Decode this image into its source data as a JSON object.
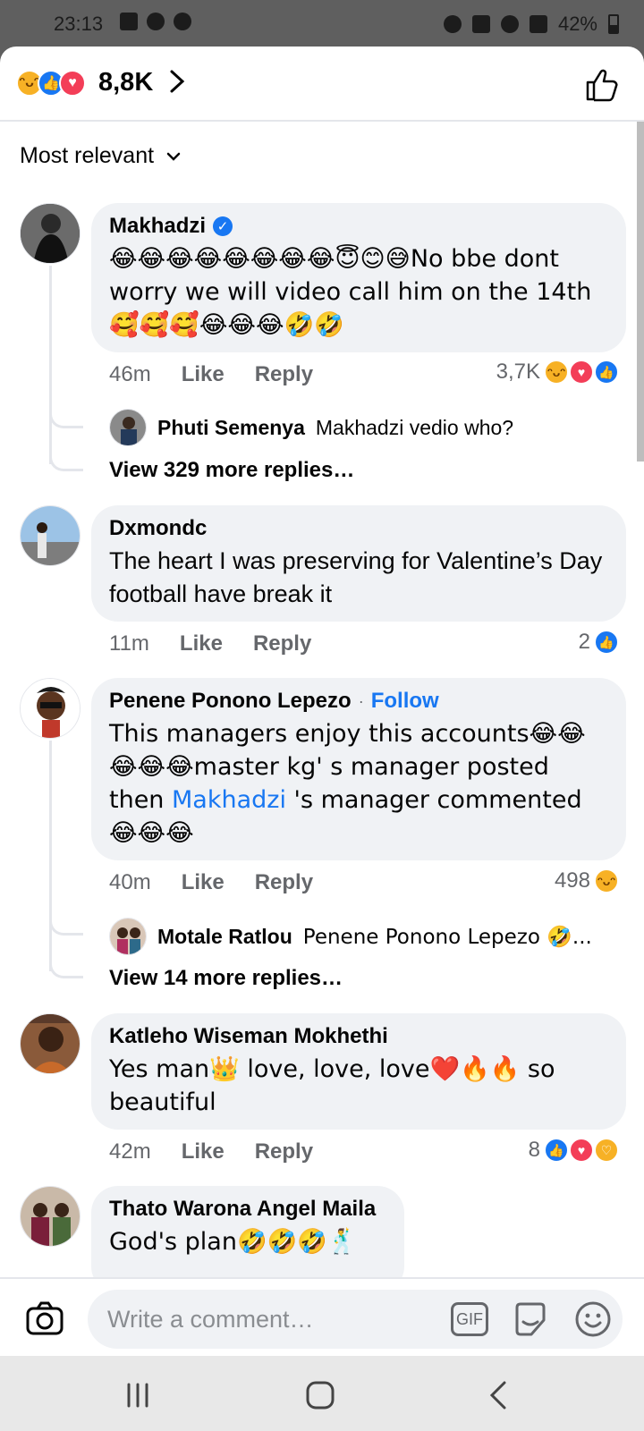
{
  "status_bar": {
    "time": "23:13",
    "battery": "42%"
  },
  "header": {
    "reaction_total": "8,8K"
  },
  "sort": {
    "label": "Most relevant"
  },
  "comments": [
    {
      "author": "Makhadzi",
      "verified": true,
      "text": "😂😂😂😂😂😂😂😂😇😊😅No bbe dont worry we will video call him on the 14th 🥰🥰🥰😂😂😂🤣🤣",
      "time": "46m",
      "like": "Like",
      "reply": "Reply",
      "reaction_count": "3,7K",
      "reply_preview": {
        "author": "Phuti Semenya",
        "text": "Makhadzi vedio who?"
      },
      "view_more": "View 329 more replies…"
    },
    {
      "author": "Dxmondc",
      "text": "The heart I was preserving for Valentine’s Day football have break it",
      "time": "11m",
      "like": "Like",
      "reply": "Reply",
      "reaction_count": "2"
    },
    {
      "author": "Penene Ponono Lepezo",
      "follow": "Follow",
      "text_a": "This managers enjoy this accounts😂😂😂😂😂master kg' s manager posted then ",
      "text_link": "Makhadzi",
      "text_b": " 's manager commented 😂😂😂",
      "time": "40m",
      "like": "Like",
      "reply": "Reply",
      "reaction_count": "498",
      "reply_preview": {
        "author": "Motale Ratlou",
        "text": "Penene Ponono Lepezo 🤣..."
      },
      "view_more": "View 14 more replies…"
    },
    {
      "author": "Katleho Wiseman Mokhethi",
      "text": "Yes man👑 love, love, love❤️🔥🔥 so beautiful",
      "time": "42m",
      "like": "Like",
      "reply": "Reply",
      "reaction_count": "8"
    },
    {
      "author": "Thato Warona Angel Maila",
      "text": "God's plan🤣🤣🤣🕺"
    }
  ],
  "composer": {
    "placeholder": "Write a comment…",
    "gif": "GIF"
  },
  "colors": {
    "accent": "#1877f2",
    "bubble": "#f0f2f5",
    "love": "#f33e58",
    "haha": "#f7b125"
  }
}
